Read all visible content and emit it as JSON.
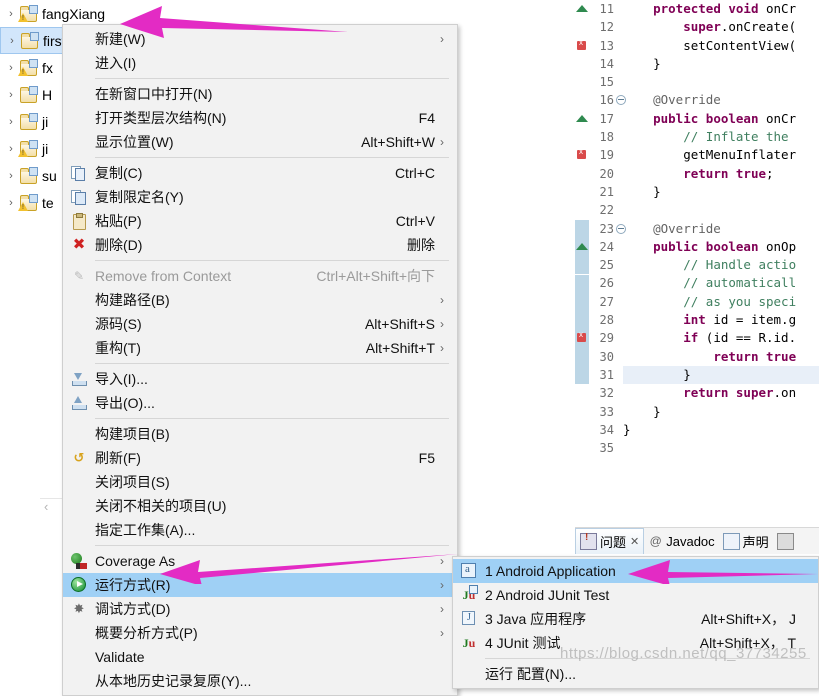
{
  "explorer": {
    "items": [
      {
        "label": "fangXiang",
        "selected": false,
        "warn": true
      },
      {
        "label": "firstapp",
        "selected": true,
        "warn": false
      },
      {
        "label": "fx",
        "selected": false,
        "warn": true
      },
      {
        "label": "H",
        "selected": false,
        "warn": false
      },
      {
        "label": "ji",
        "selected": false,
        "warn": false
      },
      {
        "label": "ji",
        "selected": false,
        "warn": true
      },
      {
        "label": "su",
        "selected": false,
        "warn": false
      },
      {
        "label": "te",
        "selected": false,
        "warn": true
      }
    ],
    "twisty": "›"
  },
  "context_menu": {
    "items": [
      {
        "type": "item",
        "label": "新建(W)",
        "accel": "",
        "arrow": true,
        "icon": "none"
      },
      {
        "type": "item",
        "label": "进入(I)",
        "accel": "",
        "arrow": false,
        "icon": "none"
      },
      {
        "type": "separator"
      },
      {
        "type": "item",
        "label": "在新窗口中打开(N)",
        "accel": "",
        "arrow": false,
        "icon": "none"
      },
      {
        "type": "item",
        "label": "打开类型层次结构(N)",
        "accel": "F4",
        "arrow": false,
        "icon": "none"
      },
      {
        "type": "item",
        "label": "显示位置(W)",
        "accel": "Alt+Shift+W",
        "arrow": true,
        "icon": "none"
      },
      {
        "type": "separator"
      },
      {
        "type": "item",
        "label": "复制(C)",
        "accel": "Ctrl+C",
        "arrow": false,
        "icon": "copy-icon"
      },
      {
        "type": "item",
        "label": "复制限定名(Y)",
        "accel": "",
        "arrow": false,
        "icon": "copy-qualified-name-icon"
      },
      {
        "type": "item",
        "label": "粘贴(P)",
        "accel": "Ctrl+V",
        "arrow": false,
        "icon": "paste-icon"
      },
      {
        "type": "item",
        "label": "删除(D)",
        "accel": "删除",
        "arrow": false,
        "icon": "delete-icon"
      },
      {
        "type": "separator"
      },
      {
        "type": "item",
        "label": "Remove from Context",
        "accel": "Ctrl+Alt+Shift+向下",
        "arrow": false,
        "icon": "remove-from-context-icon",
        "disabled": true
      },
      {
        "type": "item",
        "label": "构建路径(B)",
        "accel": "",
        "arrow": true,
        "icon": "none"
      },
      {
        "type": "item",
        "label": "源码(S)",
        "accel": "Alt+Shift+S",
        "arrow": true,
        "icon": "none"
      },
      {
        "type": "item",
        "label": "重构(T)",
        "accel": "Alt+Shift+T",
        "arrow": true,
        "icon": "none"
      },
      {
        "type": "separator"
      },
      {
        "type": "item",
        "label": "导入(I)...",
        "accel": "",
        "arrow": false,
        "icon": "import-icon"
      },
      {
        "type": "item",
        "label": "导出(O)...",
        "accel": "",
        "arrow": false,
        "icon": "export-icon"
      },
      {
        "type": "separator"
      },
      {
        "type": "item",
        "label": "构建项目(B)",
        "accel": "",
        "arrow": false,
        "icon": "none"
      },
      {
        "type": "item",
        "label": "刷新(F)",
        "accel": "F5",
        "arrow": false,
        "icon": "refresh-icon"
      },
      {
        "type": "item",
        "label": "关闭项目(S)",
        "accel": "",
        "arrow": false,
        "icon": "none"
      },
      {
        "type": "item",
        "label": "关闭不相关的项目(U)",
        "accel": "",
        "arrow": false,
        "icon": "none"
      },
      {
        "type": "item",
        "label": "指定工作集(A)...",
        "accel": "",
        "arrow": false,
        "icon": "none"
      },
      {
        "type": "separator"
      },
      {
        "type": "item",
        "label": "Coverage As",
        "accel": "",
        "arrow": true,
        "icon": "coverage-icon"
      },
      {
        "type": "item",
        "label": "运行方式(R)",
        "accel": "",
        "arrow": true,
        "icon": "run-icon",
        "highlight": true
      },
      {
        "type": "item",
        "label": "调试方式(D)",
        "accel": "",
        "arrow": true,
        "icon": "debug-icon"
      },
      {
        "type": "item",
        "label": "概要分析方式(P)",
        "accel": "",
        "arrow": true,
        "icon": "none"
      },
      {
        "type": "item",
        "label": "Validate",
        "accel": "",
        "arrow": false,
        "icon": "none"
      },
      {
        "type": "item",
        "label": "从本地历史记录复原(Y)...",
        "accel": "",
        "arrow": false,
        "icon": "none"
      }
    ]
  },
  "submenu": {
    "items": [
      {
        "type": "item",
        "label": "1 Android Application",
        "accel": "",
        "icon": "android-application-icon",
        "highlight": true
      },
      {
        "type": "item",
        "label": "2 Android JUnit Test",
        "accel": "",
        "icon": "android-junit-icon"
      },
      {
        "type": "item",
        "label": "3 Java 应用程序",
        "accel": "Alt+Shift+X， J",
        "icon": "java-application-icon"
      },
      {
        "type": "item",
        "label": "4 JUnit 测试",
        "accel": "Alt+Shift+X， T",
        "icon": "junit-icon"
      },
      {
        "type": "separator"
      },
      {
        "type": "item",
        "label": "运行 配置(N)...",
        "accel": "",
        "icon": "none"
      }
    ]
  },
  "editor": {
    "lines": [
      {
        "num": "11",
        "fold": false,
        "marker": "triangle",
        "highlight": false,
        "tokens": [
          {
            "t": "    ",
            "c": "pl"
          },
          {
            "t": "protected void ",
            "c": "kw"
          },
          {
            "t": "onCr",
            "c": "pl"
          }
        ]
      },
      {
        "num": "12",
        "fold": false,
        "marker": "",
        "highlight": false,
        "tokens": [
          {
            "t": "        ",
            "c": "pl"
          },
          {
            "t": "super",
            "c": "kw"
          },
          {
            "t": ".onCreate(",
            "c": "pl"
          }
        ]
      },
      {
        "num": "13",
        "fold": false,
        "marker": "error",
        "highlight": false,
        "tokens": [
          {
            "t": "        setContentView(",
            "c": "pl"
          }
        ]
      },
      {
        "num": "14",
        "fold": false,
        "marker": "",
        "highlight": false,
        "tokens": [
          {
            "t": "    }",
            "c": "pl"
          }
        ]
      },
      {
        "num": "15",
        "fold": false,
        "marker": "",
        "highlight": false,
        "tokens": [
          {
            "t": "",
            "c": "pl"
          }
        ]
      },
      {
        "num": "16",
        "fold": true,
        "marker": "",
        "highlight": false,
        "tokens": [
          {
            "t": "    @Override",
            "c": "an"
          }
        ]
      },
      {
        "num": "17",
        "fold": false,
        "marker": "triangle",
        "highlight": false,
        "tokens": [
          {
            "t": "    ",
            "c": "pl"
          },
          {
            "t": "public boolean ",
            "c": "kw"
          },
          {
            "t": "onCr",
            "c": "pl"
          }
        ]
      },
      {
        "num": "18",
        "fold": false,
        "marker": "",
        "highlight": false,
        "tokens": [
          {
            "t": "        ",
            "c": "pl"
          },
          {
            "t": "// Inflate the",
            "c": "cm"
          }
        ]
      },
      {
        "num": "19",
        "fold": false,
        "marker": "error",
        "highlight": false,
        "tokens": [
          {
            "t": "        getMenuInflater",
            "c": "pl"
          }
        ]
      },
      {
        "num": "20",
        "fold": false,
        "marker": "",
        "highlight": false,
        "tokens": [
          {
            "t": "        ",
            "c": "pl"
          },
          {
            "t": "return true",
            "c": "kw"
          },
          {
            "t": ";",
            "c": "pl"
          }
        ]
      },
      {
        "num": "21",
        "fold": false,
        "marker": "",
        "highlight": false,
        "tokens": [
          {
            "t": "    }",
            "c": "pl"
          }
        ]
      },
      {
        "num": "22",
        "fold": false,
        "marker": "",
        "highlight": false,
        "tokens": [
          {
            "t": "",
            "c": "pl"
          }
        ]
      },
      {
        "num": "23",
        "fold": true,
        "marker": "block",
        "highlight": false,
        "tokens": [
          {
            "t": "    @Override",
            "c": "an"
          }
        ]
      },
      {
        "num": "24",
        "fold": false,
        "marker": "block-triangle",
        "highlight": false,
        "tokens": [
          {
            "t": "    ",
            "c": "pl"
          },
          {
            "t": "public boolean ",
            "c": "kw"
          },
          {
            "t": "onOp",
            "c": "pl"
          }
        ]
      },
      {
        "num": "25",
        "fold": false,
        "marker": "block",
        "highlight": false,
        "tokens": [
          {
            "t": "        ",
            "c": "pl"
          },
          {
            "t": "// Handle actio",
            "c": "cm"
          }
        ]
      },
      {
        "num": "26",
        "fold": false,
        "marker": "block",
        "highlight": false,
        "tokens": [
          {
            "t": "        ",
            "c": "pl"
          },
          {
            "t": "// automaticall",
            "c": "cm"
          }
        ]
      },
      {
        "num": "27",
        "fold": false,
        "marker": "block",
        "highlight": false,
        "tokens": [
          {
            "t": "        ",
            "c": "pl"
          },
          {
            "t": "// as you speci",
            "c": "cm"
          }
        ]
      },
      {
        "num": "28",
        "fold": false,
        "marker": "block",
        "highlight": false,
        "tokens": [
          {
            "t": "        ",
            "c": "pl"
          },
          {
            "t": "int ",
            "c": "kw"
          },
          {
            "t": "id = item.g",
            "c": "pl"
          }
        ]
      },
      {
        "num": "29",
        "fold": false,
        "marker": "block-error",
        "highlight": false,
        "tokens": [
          {
            "t": "        ",
            "c": "pl"
          },
          {
            "t": "if ",
            "c": "kw"
          },
          {
            "t": "(id == R.id.",
            "c": "pl"
          }
        ]
      },
      {
        "num": "30",
        "fold": false,
        "marker": "block",
        "highlight": false,
        "tokens": [
          {
            "t": "            ",
            "c": "pl"
          },
          {
            "t": "return true",
            "c": "kw"
          }
        ]
      },
      {
        "num": "31",
        "fold": false,
        "marker": "block",
        "highlight": true,
        "tokens": [
          {
            "t": "        }",
            "c": "pl"
          }
        ]
      },
      {
        "num": "32",
        "fold": false,
        "marker": "",
        "highlight": false,
        "tokens": [
          {
            "t": "        ",
            "c": "pl"
          },
          {
            "t": "return super",
            "c": "kw"
          },
          {
            "t": ".on",
            "c": "pl"
          }
        ]
      },
      {
        "num": "33",
        "fold": false,
        "marker": "",
        "highlight": false,
        "tokens": [
          {
            "t": "    }",
            "c": "pl"
          }
        ]
      },
      {
        "num": "34",
        "fold": false,
        "marker": "",
        "highlight": false,
        "tokens": [
          {
            "t": "}",
            "c": "pl"
          }
        ]
      },
      {
        "num": "35",
        "fold": false,
        "marker": "",
        "highlight": false,
        "tokens": [
          {
            "t": "",
            "c": "pl"
          }
        ]
      }
    ],
    "hscroll_left_glyph": "‹"
  },
  "view_tabs": {
    "tabs": [
      {
        "label": "问题",
        "icon": "problems-icon",
        "active": true,
        "close": "✕"
      },
      {
        "label": "Javadoc",
        "icon": "at-icon",
        "active": false,
        "close": ""
      },
      {
        "label": "声明",
        "icon": "declaration-icon",
        "active": false,
        "close": ""
      },
      {
        "label": "",
        "icon": "console-icon",
        "active": false,
        "close": ""
      }
    ]
  },
  "watermark": {
    "text": "https://blog.csdn.net/qq_37734255"
  },
  "colors": {
    "menu_bg": "#f2f2f2",
    "menu_highlight": "#9fd0f5",
    "tree_selection": "#d2e6fb",
    "arrow_pink": "#e32bc4",
    "keyword": "#7f0055",
    "comment": "#3f7f5f",
    "annotation": "#646464"
  }
}
